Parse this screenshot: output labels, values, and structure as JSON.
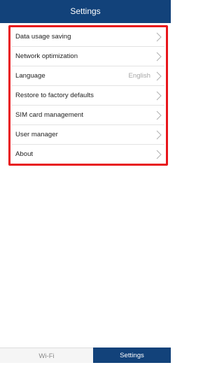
{
  "header": {
    "title": "Settings"
  },
  "menu": {
    "items": [
      {
        "label": "Data usage saving",
        "value": ""
      },
      {
        "label": "Network optimization",
        "value": ""
      },
      {
        "label": "Language",
        "value": "English"
      },
      {
        "label": "Restore to factory defaults",
        "value": ""
      },
      {
        "label": "SIM card management",
        "value": ""
      },
      {
        "label": "User manager",
        "value": ""
      },
      {
        "label": "About",
        "value": ""
      }
    ]
  },
  "tabs": [
    {
      "label": "Wi-Fi",
      "active": false
    },
    {
      "label": "Settings",
      "active": true
    }
  ],
  "colors": {
    "primary": "#12427a",
    "highlight_border": "#e8161b",
    "divider": "#e3e3e3",
    "chevron": "#b0b0b0"
  },
  "icons": {
    "row_chevron": "chevron-right-icon"
  }
}
